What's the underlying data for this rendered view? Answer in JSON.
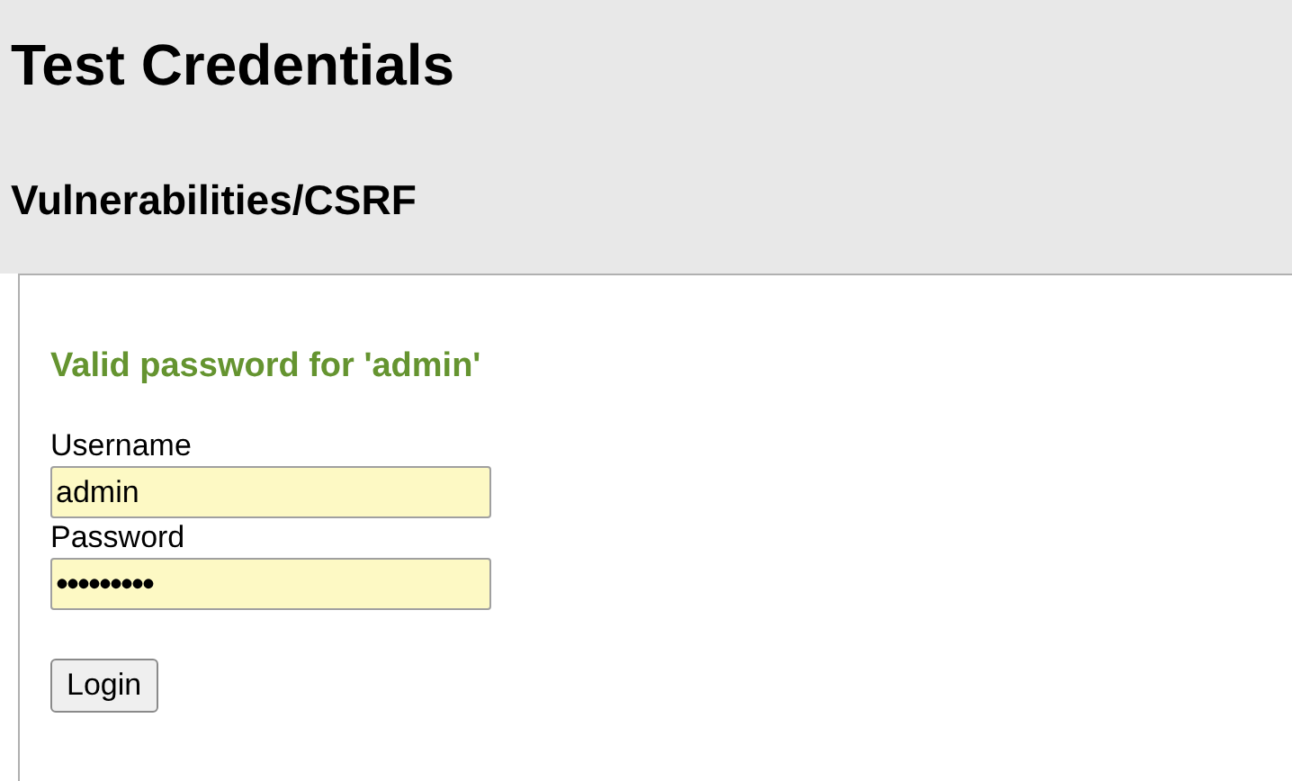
{
  "header": {
    "title": "Test Credentials",
    "subtitle": "Vulnerabilities/CSRF"
  },
  "message": "Valid password for 'admin'",
  "fields": [
    {
      "label": "Username",
      "value": "admin"
    },
    {
      "label": "Password",
      "value": "•••••••••"
    }
  ],
  "button": "Login"
}
